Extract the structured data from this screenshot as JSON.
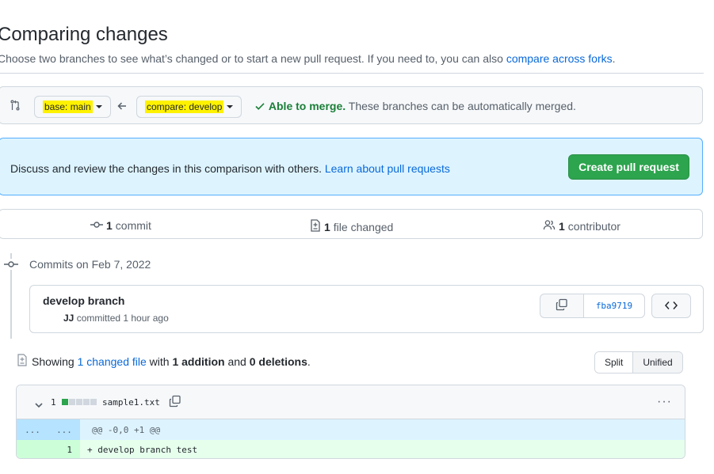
{
  "page": {
    "title": "Comparing changes",
    "subtitle_text": "Choose two branches to see what’s changed or to start a new pull request. If you need to, you can also ",
    "subtitle_link": "compare across forks",
    "subtitle_end": "."
  },
  "range": {
    "base_label": "base: main",
    "compare_label": "compare: develop",
    "merge_status": "Able to merge.",
    "merge_note": " These branches can be automatically merged."
  },
  "blankslate": {
    "text": "Discuss and review the changes in this comparison with others. ",
    "link": "Learn about pull requests",
    "create_button": "Create pull request"
  },
  "summary": {
    "commits_count": "1",
    "commits_label": "commit",
    "files_count": "1",
    "files_label": "file changed",
    "contributors_count": "1",
    "contributors_label": "contributor"
  },
  "commits": {
    "group_label": "Commits on Feb 7, 2022",
    "items": [
      {
        "message": "develop branch",
        "author": "JJ",
        "action": " committed 1 hour ago",
        "sha": "fba9719"
      }
    ]
  },
  "diff": {
    "showing_prefix": "Showing ",
    "changed_files_link": "1 changed file",
    "with": " with ",
    "additions": "1 addition",
    "and": " and ",
    "deletions": "0 deletions",
    "end": ".",
    "split_label": "Split",
    "unified_label": "Unified",
    "file": {
      "count": "1",
      "name": "sample1.txt",
      "hunk_old": "...",
      "hunk_new": "...",
      "hunk_header": "@@ -0,0 +1 @@",
      "line_new_num": "1",
      "line_text": "+ develop branch test"
    }
  },
  "colors": {
    "accent": "#0969da",
    "success": "#2da44e",
    "highlight": "#fff200"
  }
}
